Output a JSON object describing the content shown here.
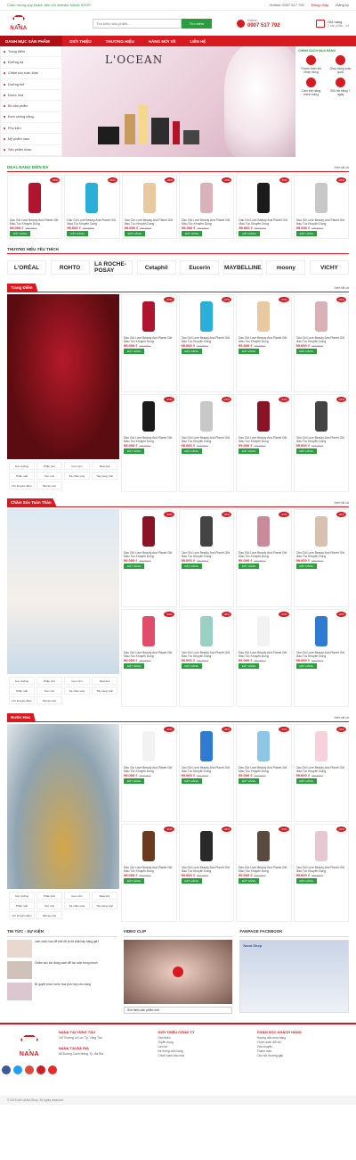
{
  "topbar": {
    "welcome": "Chào mừng quý khách đến với website NANA SHOP",
    "phone": "Hotline: 0907 517 792",
    "login": "Đăng nhập",
    "register": "Đăng ký"
  },
  "header": {
    "logo": "NANA",
    "search_placeholder": "Tìm kiếm sản phẩm...",
    "search_button": "Tìm kiếm",
    "hotline_label": "Hotline",
    "hotline_number": "0907 517 792",
    "cart_label": "Giỏ hàng",
    "cart_count": "0 sản phẩm - 0đ"
  },
  "nav": {
    "category": "DANH MỤC SẢN PHẨM",
    "items": [
      "GIỚI THIỆU",
      "THƯƠNG HIỆU",
      "HÀNG MỚI VỀ",
      "LIÊN HỆ"
    ]
  },
  "sidebar": [
    "Trang điểm",
    "Dưỡng da",
    "Chăm sóc toàn thân",
    "Dưỡng thể",
    "Nước hoa",
    "Bộ sản phẩm",
    "Kem chống nắng",
    "Phụ kiện",
    "Mỹ phẩm nam",
    "Sản phẩm khác"
  ],
  "banner": {
    "brand": "L'OCEAN"
  },
  "policy": {
    "title": "CHÍNH SÁCH MUA HÀNG",
    "items": [
      "Thanh toán khi nhận hàng",
      "Giao hàng toàn quốc",
      "Cam kết hàng chính hãng",
      "Đổi trả hàng 7 ngày"
    ]
  },
  "deal": {
    "title": "DEAL ĐANG DIỄN RA",
    "more": "Xem tất cả"
  },
  "product": {
    "name": "Dầu Gội Love Beauty And Planet Giữ Màu Tóc Khuyên Dùng",
    "price": "99.000 ₫",
    "old": "150.000 ₫",
    "buy": "ĐẶT HÀNG",
    "sale": "-35%"
  },
  "brands_title": "THƯƠNG HIỆU YÊU THÍCH",
  "brands": [
    "L'ORÉAL",
    "ROHTO",
    "LA ROCHE-POSAY",
    "Cetaphil",
    "Eucerin",
    "MAYBELLINE",
    "moony",
    "VICHY"
  ],
  "cat1": {
    "title": "Trang Điểm",
    "more": "Xem tất cả"
  },
  "cat2": {
    "title": "Chăm Sóc Toàn Thân",
    "more": "Xem tất cả"
  },
  "cat3": {
    "title": "Nước Hoa",
    "more": "Xem tất cả"
  },
  "cat_tags": [
    "Son dưỡng",
    "Phấn phủ",
    "Kem nền",
    "Mascara",
    "Phấn mắt",
    "Son môi",
    "Kẻ chân mày",
    "Tẩy trang mặt",
    "Chì khuyến điểm",
    "Bút kẻ mắt"
  ],
  "news": {
    "title": "TIN TỨC - SỰ KIỆN",
    "items": [
      "Làm cách nào để biết đó là đồ thật hay hàng giả?",
      "Chăm sóc tóc đúng cách để tóc luôn bóng mượt",
      "Bí quyết chọn nước hoa phù hợp cho nàng"
    ]
  },
  "video": {
    "title": "VIDEO CLIP",
    "select": "Giới thiệu sản phẩm mới"
  },
  "fanpage": {
    "title": "FANPAGE FACEBOOK",
    "page": "Nana Shop"
  },
  "footer": {
    "logo": "NANA",
    "store1": "NANA TẠI VŨNG TÀU",
    "store1_addr": "167 Đường Lê Lợi, Tp. Vũng Tàu",
    "store2": "NANA TẠI BÀ RỊA",
    "store2_addr": "68 Đường Cách Mạng, Tp. Bà Rịa",
    "col3": "GIỚI THIỆU CÔNG TY",
    "col3_items": [
      "Giới thiệu",
      "Tuyển dụng",
      "Liên hệ",
      "Hệ thống cửa hàng",
      "Chính sách bảo mật"
    ],
    "col4": "CHĂM SÓC KHÁCH HÀNG",
    "col4_items": [
      "Hướng dẫn mua hàng",
      "Chính sách đổi trả",
      "Vận chuyển",
      "Thanh toán",
      "Câu hỏi thường gặp"
    ]
  },
  "copyright": "© 2019 bởi NANA Shop. All rights reserved."
}
